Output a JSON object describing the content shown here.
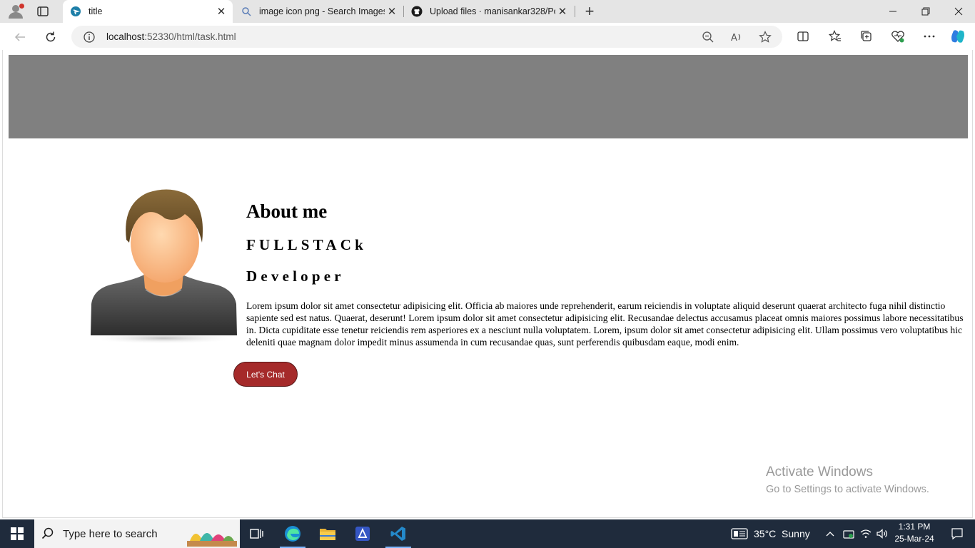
{
  "browser": {
    "tabs": [
      {
        "title": "title",
        "active": true
      },
      {
        "title": "image icon png - Search Images",
        "active": false
      },
      {
        "title": "Upload files · manisankar328/Por",
        "active": false
      }
    ],
    "address": {
      "host": "localhost",
      "rest": ":52330/html/task.html"
    }
  },
  "page": {
    "heading": "About me",
    "role_line1": "FULLSTACk",
    "role_line2": "Developer",
    "bio": "Lorem ipsum dolor sit amet consectetur adipisicing elit. Officia ab maiores unde reprehenderit, earum reiciendis in voluptate aliquid deserunt quaerat architecto fuga nihil distinctio sapiente sed est natus. Quaerat, deserunt! Lorem ipsum dolor sit amet consectetur adipisicing elit. Recusandae delectus accusamus placeat omnis maiores possimus labore necessitatibus in. Dicta cupiditate esse tenetur reiciendis rem asperiores ex a nesciunt nulla voluptatem. Lorem, ipsum dolor sit amet consectetur adipisicing elit. Ullam possimus vero voluptatibus hic deleniti quae magnam dolor impedit minus assumenda in cum recusandae quas, sunt perferendis quibusdam eaque, modi enim.",
    "chat_button": "Let's Chat",
    "colors": {
      "header_band": "#808080",
      "button": "#a52a2a"
    }
  },
  "watermark": {
    "line1": "Activate Windows",
    "line2": "Go to Settings to activate Windows."
  },
  "taskbar": {
    "search_placeholder": "Type here to search",
    "weather": "35°C  Sunny",
    "time": "1:31 PM",
    "date": "25-Mar-24"
  }
}
